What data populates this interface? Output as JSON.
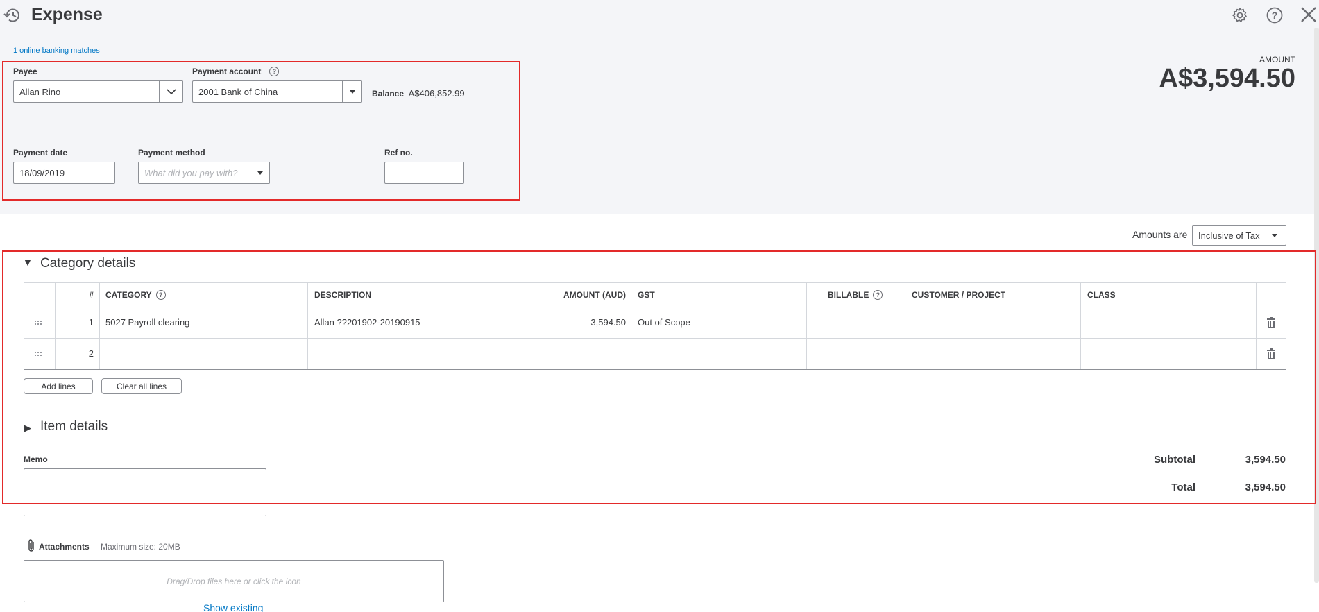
{
  "header": {
    "title": "Expense",
    "icons": [
      "recent-transactions-icon",
      "gear-icon",
      "help-icon",
      "close-icon"
    ]
  },
  "banking": {
    "matches_link": "1 online banking matches"
  },
  "payee": {
    "label": "Payee",
    "value": "Allan Rino"
  },
  "payment_account": {
    "label": "Payment account",
    "value": "2001 Bank of China",
    "help": "?"
  },
  "balance": {
    "label": "Balance",
    "value": "A$406,852.99"
  },
  "amount": {
    "label": "AMOUNT",
    "value": "A$3,594.50"
  },
  "payment_date": {
    "label": "Payment date",
    "value": "18/09/2019"
  },
  "payment_method": {
    "label": "Payment method",
    "placeholder": "What did you pay with?"
  },
  "ref_no": {
    "label": "Ref no.",
    "value": ""
  },
  "amounts_are": {
    "label": "Amounts are",
    "value": "Inclusive of Tax"
  },
  "category_details": {
    "title": "Category details",
    "toggle": "▼",
    "columns": {
      "num": "#",
      "category": "CATEGORY",
      "description": "DESCRIPTION",
      "amount": "AMOUNT (AUD)",
      "gst": "GST",
      "billable": "BILLABLE",
      "customer": "CUSTOMER / PROJECT",
      "class": "CLASS"
    },
    "rows": [
      {
        "num": "1",
        "category": "5027 Payroll clearing",
        "description": "Allan ??201902-20190915",
        "amount": "3,594.50",
        "gst": "Out of Scope"
      },
      {
        "num": "2",
        "category": "",
        "description": "",
        "amount": "",
        "gst": ""
      }
    ],
    "add_lines": "Add lines",
    "clear_all_lines": "Clear all lines"
  },
  "item_details": {
    "title": "Item details",
    "toggle": "▶"
  },
  "memo": {
    "label": "Memo",
    "value": ""
  },
  "totals": {
    "subtotal_label": "Subtotal",
    "subtotal_value": "3,594.50",
    "total_label": "Total",
    "total_value": "3,594.50"
  },
  "attachments": {
    "label": "Attachments",
    "max_size": "Maximum size: 20MB",
    "drop_hint": "Drag/Drop files here or click the icon",
    "show_existing": "Show existing"
  },
  "colors": {
    "annotation": "#e32a2a",
    "link": "#0077c5",
    "top_bg": "#f4f5f8"
  }
}
